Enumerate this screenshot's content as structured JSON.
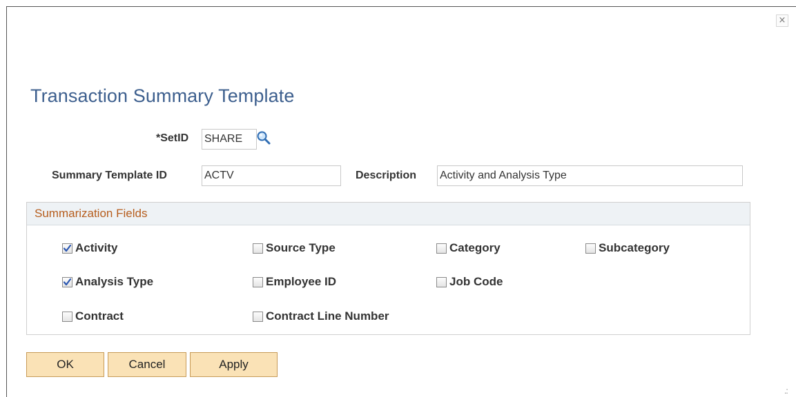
{
  "window": {
    "close_glyph": "×",
    "close_icon": "close-icon",
    "resize_icon": "resize-grip-icon"
  },
  "page": {
    "title": "Transaction Summary Template"
  },
  "setid": {
    "label": "*SetID",
    "value": "SHARE",
    "lookup_icon": "magnifier-icon"
  },
  "template_id": {
    "label": "Summary Template ID",
    "value": "ACTV"
  },
  "description": {
    "label": "Description",
    "value": "Activity and Analysis Type"
  },
  "summarization": {
    "heading": "Summarization Fields",
    "fields": [
      {
        "label": "Activity",
        "checked": true
      },
      {
        "label": "Source Type",
        "checked": false
      },
      {
        "label": "Category",
        "checked": false
      },
      {
        "label": "Subcategory",
        "checked": false
      },
      {
        "label": "Analysis Type",
        "checked": true
      },
      {
        "label": "Employee ID",
        "checked": false
      },
      {
        "label": "Job Code",
        "checked": false
      },
      {
        "label": "Contract",
        "checked": false
      },
      {
        "label": "Contract Line Number",
        "checked": false
      }
    ]
  },
  "buttons": {
    "ok": "OK",
    "cancel": "Cancel",
    "apply": "Apply"
  },
  "colors": {
    "title": "#3d5f8e",
    "group_heading": "#b65d1d",
    "button_bg": "#fae2b6",
    "button_border": "#c79a56"
  }
}
